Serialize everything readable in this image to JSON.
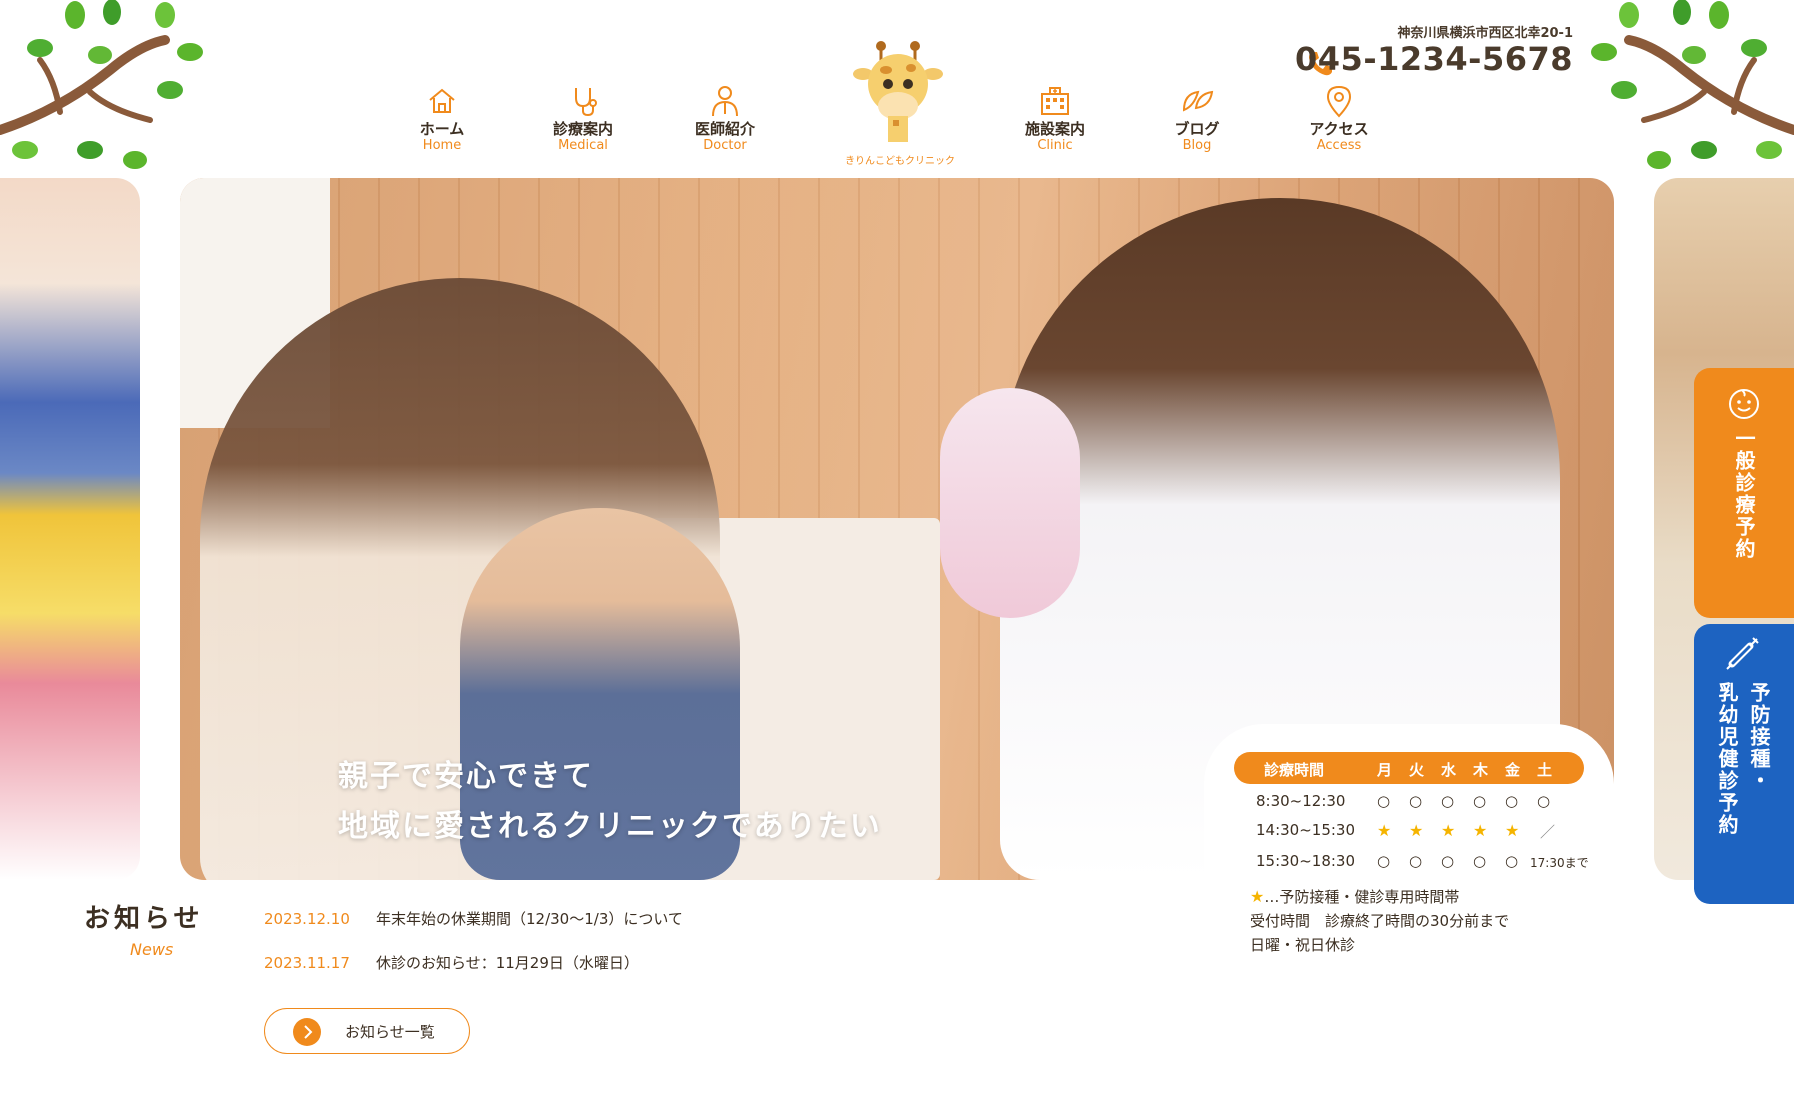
{
  "header": {
    "address": "神奈川県横浜市西区北幸20-1",
    "phone": "045-1234-5678",
    "logo_text": "きりんこどもクリニック",
    "nav": [
      {
        "jp": "ホーム",
        "en": "Home",
        "icon": "house-icon"
      },
      {
        "jp": "診療案内",
        "en": "Medical",
        "icon": "stethoscope-icon"
      },
      {
        "jp": "医師紹介",
        "en": "Doctor",
        "icon": "doctor-icon"
      },
      {
        "jp": "施設案内",
        "en": "Clinic",
        "icon": "building-icon"
      },
      {
        "jp": "ブログ",
        "en": "Blog",
        "icon": "leaf-icon"
      },
      {
        "jp": "アクセス",
        "en": "Access",
        "icon": "map-pin-icon"
      }
    ]
  },
  "hero": {
    "line1": "親子で安心できて",
    "line2": "地域に愛されるクリニックでありたい"
  },
  "hours": {
    "header": [
      "診療時間",
      "月",
      "火",
      "水",
      "木",
      "金",
      "土"
    ],
    "rows": [
      {
        "time": "8:30~12:30",
        "marks": [
          "○",
          "○",
          "○",
          "○",
          "○",
          "○"
        ]
      },
      {
        "time": "14:30~15:30",
        "marks": [
          "★",
          "★",
          "★",
          "★",
          "★",
          "／"
        ]
      },
      {
        "time": "15:30~18:30",
        "marks": [
          "○",
          "○",
          "○",
          "○",
          "○",
          "17:30まで"
        ]
      }
    ],
    "notes": [
      "…予防接種・健診専用時間帯",
      "受付時間　診療終了時間の30分前まで",
      "日曜・祝日休診"
    ],
    "star": "★"
  },
  "cta": {
    "general": "一般診療予約",
    "vaccine_line1": "予防接種・",
    "vaccine_line2": "乳幼児健診予約"
  },
  "news": {
    "title": "お知らせ",
    "subtitle": "News",
    "items": [
      {
        "date": "2023.12.10",
        "text": "年末年始の休業期間（12/30〜1/3）について"
      },
      {
        "date": "2023.11.17",
        "text": "休診のお知らせ：11月29日（水曜日）"
      }
    ],
    "more": "お知らせ一覧"
  },
  "colors": {
    "accent": "#f08a1c",
    "blue": "#1d63c1",
    "text": "#3c2f22"
  }
}
